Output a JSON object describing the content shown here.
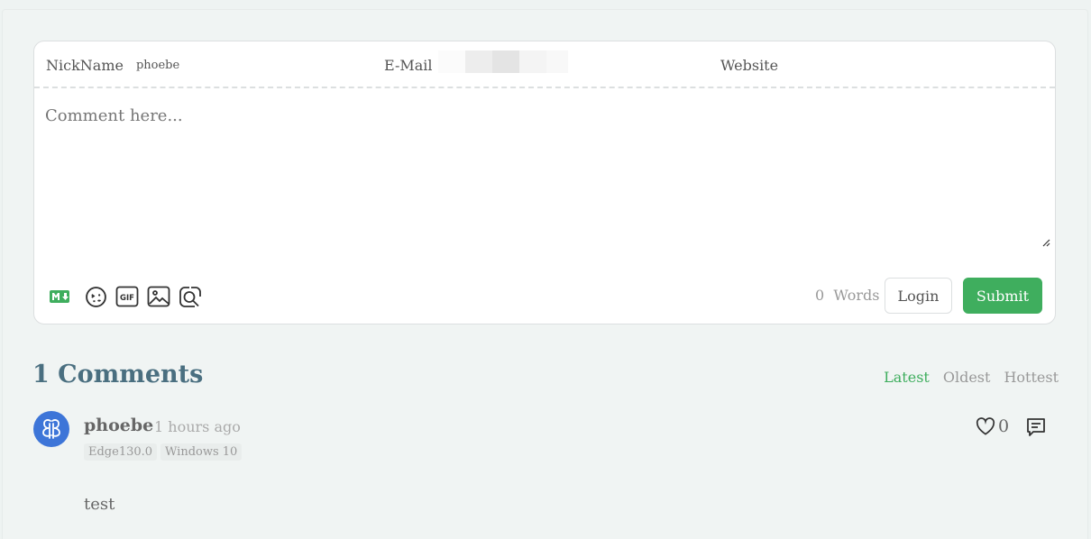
{
  "form": {
    "nickname_label": "NickName",
    "nickname_value": "phoebe",
    "email_label": "E-Mail",
    "email_value": "",
    "website_label": "Website",
    "website_value": "",
    "comment_placeholder": "Comment here...",
    "toolbar_icons": [
      "markdown-icon",
      "emoji-icon",
      "gif-icon",
      "image-icon",
      "preview-icon"
    ],
    "word_count": "0",
    "word_count_unit": "Words",
    "login_label": "Login",
    "submit_label": "Submit"
  },
  "comments": {
    "count_title": "1 Comments",
    "sort_tabs": [
      "Latest",
      "Oldest",
      "Hottest"
    ],
    "active_sort": "Latest",
    "items": [
      {
        "author": "phoebe",
        "time": "1 hours ago",
        "badges": [
          "Edge130.0",
          "Windows 10"
        ],
        "likes": "0",
        "body": "test"
      }
    ]
  },
  "colors": {
    "accent": "#3fae5e",
    "title": "#4a6f80",
    "avatar": "#3d75d8",
    "background": "#f0f4f3"
  }
}
